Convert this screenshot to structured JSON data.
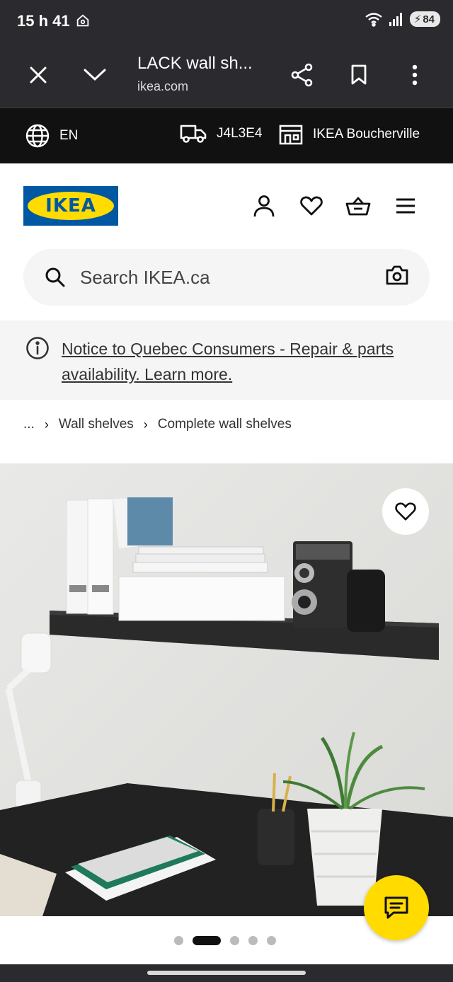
{
  "status_bar": {
    "time": "15 h 41",
    "battery": "84"
  },
  "browser": {
    "title": "LACK wall sh...",
    "url": "ikea.com"
  },
  "top_strip": {
    "language": "EN",
    "postal_code": "J4L3E4",
    "store": "IKEA Boucherville"
  },
  "header": {
    "logo_text": "IKEA",
    "search_placeholder": "Search IKEA.ca"
  },
  "notice": {
    "link_text": "Notice to Quebec Consumers - Repair & parts availability. Learn more."
  },
  "breadcrumb": {
    "ellipsis": "...",
    "items": [
      "Wall shelves",
      "Complete wall shelves"
    ],
    "separator": "›"
  },
  "carousel": {
    "total": 5,
    "active_index": 1
  },
  "colors": {
    "ikea_blue": "#0058a3",
    "ikea_yellow": "#ffdb00",
    "dark_bar": "#2b2b2f",
    "strip_bg": "#111111"
  }
}
